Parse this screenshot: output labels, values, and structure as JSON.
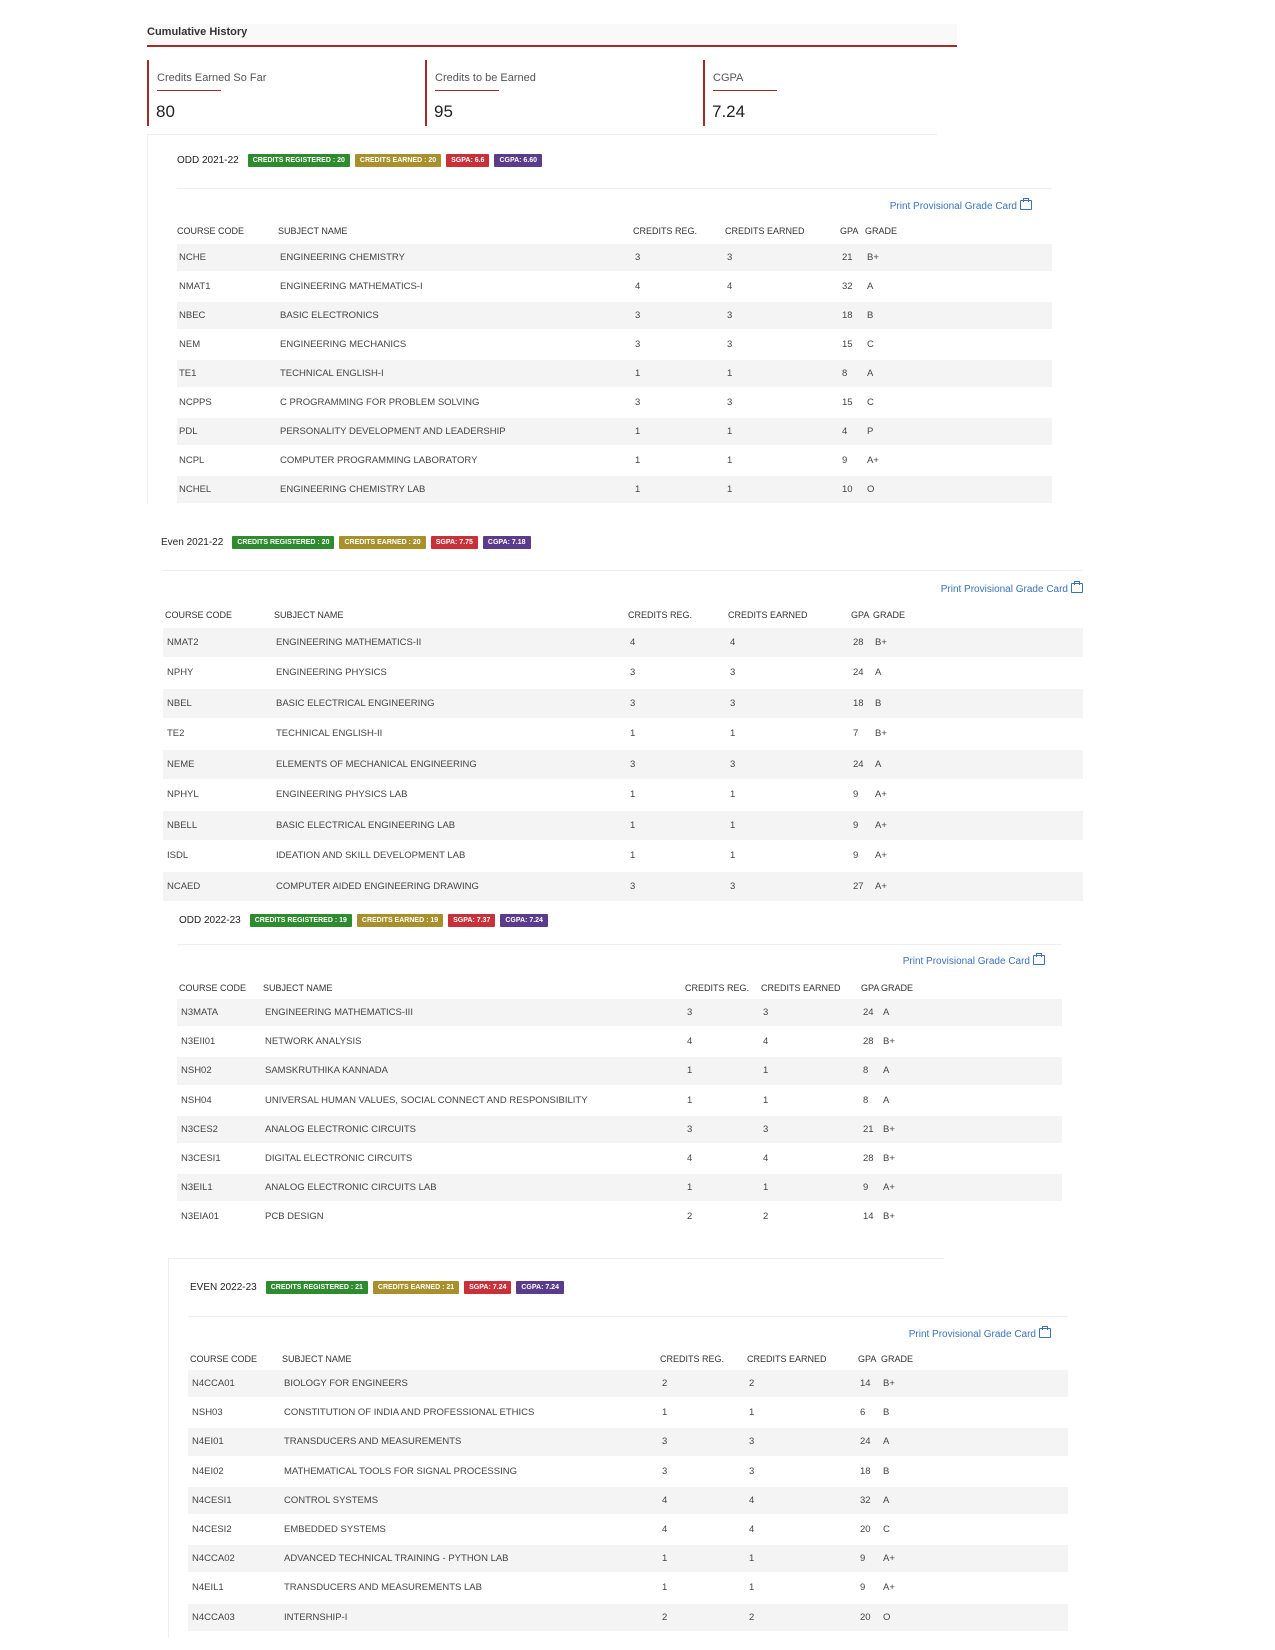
{
  "header": {
    "title": "Cumulative History"
  },
  "stats": [
    {
      "label": "Credits Earned So Far",
      "value": "80"
    },
    {
      "label": "Credits to be Earned",
      "value": "95"
    },
    {
      "label": "CGPA",
      "value": "7.24"
    }
  ],
  "print_label": "Print Provisional Grade Card",
  "columns": {
    "code": "COURSE CODE",
    "name": "SUBJECT NAME",
    "reg": "CREDITS REG.",
    "earned": "CREDITS EARNED",
    "gpa": "GPA",
    "grade": "GRADE"
  },
  "semesters": [
    {
      "name": "ODD 2021-22",
      "badges": {
        "registered": "CREDITS REGISTERED : 20",
        "earned": "CREDITS EARNED : 20",
        "sgpa": "SGPA: 6.6",
        "cgpa": "CGPA: 6.60"
      },
      "rows": [
        [
          "NCHE",
          "ENGINEERING CHEMISTRY",
          "3",
          "3",
          "21",
          "B+"
        ],
        [
          "NMAT1",
          "ENGINEERING MATHEMATICS-I",
          "4",
          "4",
          "32",
          "A"
        ],
        [
          "NBEC",
          "BASIC ELECTRONICS",
          "3",
          "3",
          "18",
          "B"
        ],
        [
          "NEM",
          "ENGINEERING MECHANICS",
          "3",
          "3",
          "15",
          "C"
        ],
        [
          "TE1",
          "TECHNICAL ENGLISH-I",
          "1",
          "1",
          "8",
          "A"
        ],
        [
          "NCPPS",
          "C PROGRAMMING FOR PROBLEM SOLVING",
          "3",
          "3",
          "15",
          "C"
        ],
        [
          "PDL",
          "PERSONALITY DEVELOPMENT AND LEADERSHIP",
          "1",
          "1",
          "4",
          "P"
        ],
        [
          "NCPL",
          "COMPUTER PROGRAMMING LABORATORY",
          "1",
          "1",
          "9",
          "A+"
        ],
        [
          "NCHEL",
          "ENGINEERING CHEMISTRY LAB",
          "1",
          "1",
          "10",
          "O"
        ]
      ]
    },
    {
      "name": "Even 2021-22",
      "badges": {
        "registered": "CREDITS REGISTERED : 20",
        "earned": "CREDITS EARNED : 20",
        "sgpa": "SGPA: 7.75",
        "cgpa": "CGPA: 7.18"
      },
      "rows": [
        [
          "NMAT2",
          "ENGINEERING MATHEMATICS-II",
          "4",
          "4",
          "28",
          "B+"
        ],
        [
          "NPHY",
          "ENGINEERING PHYSICS",
          "3",
          "3",
          "24",
          "A"
        ],
        [
          "NBEL",
          "BASIC ELECTRICAL ENGINEERING",
          "3",
          "3",
          "18",
          "B"
        ],
        [
          "TE2",
          "TECHNICAL ENGLISH-II",
          "1",
          "1",
          "7",
          "B+"
        ],
        [
          "NEME",
          "ELEMENTS OF MECHANICAL ENGINEERING",
          "3",
          "3",
          "24",
          "A"
        ],
        [
          "NPHYL",
          "ENGINEERING PHYSICS LAB",
          "1",
          "1",
          "9",
          "A+"
        ],
        [
          "NBELL",
          "BASIC ELECTRICAL ENGINEERING LAB",
          "1",
          "1",
          "9",
          "A+"
        ],
        [
          "ISDL",
          "IDEATION AND SKILL DEVELOPMENT LAB",
          "1",
          "1",
          "9",
          "A+"
        ],
        [
          "NCAED",
          "COMPUTER AIDED ENGINEERING DRAWING",
          "3",
          "3",
          "27",
          "A+"
        ]
      ]
    },
    {
      "name": "ODD 2022-23",
      "badges": {
        "registered": "CREDITS REGISTERED : 19",
        "earned": "CREDITS EARNED : 19",
        "sgpa": "SGPA: 7.37",
        "cgpa": "CGPA: 7.24"
      },
      "rows": [
        [
          "N3MATA",
          "ENGINEERING MATHEMATICS-III",
          "3",
          "3",
          "24",
          "A"
        ],
        [
          "N3EII01",
          "NETWORK ANALYSIS",
          "4",
          "4",
          "28",
          "B+"
        ],
        [
          "NSH02",
          "SAMSKRUTHIKA KANNADA",
          "1",
          "1",
          "8",
          "A"
        ],
        [
          "NSH04",
          "UNIVERSAL HUMAN VALUES, SOCIAL CONNECT AND RESPONSIBILITY",
          "1",
          "1",
          "8",
          "A"
        ],
        [
          "N3CES2",
          "ANALOG ELECTRONIC CIRCUITS",
          "3",
          "3",
          "21",
          "B+"
        ],
        [
          "N3CESI1",
          "DIGITAL ELECTRONIC CIRCUITS",
          "4",
          "4",
          "28",
          "B+"
        ],
        [
          "N3EIL1",
          "ANALOG ELECTRONIC CIRCUITS LAB",
          "1",
          "1",
          "9",
          "A+"
        ],
        [
          "N3EIA01",
          "PCB DESIGN",
          "2",
          "2",
          "14",
          "B+"
        ]
      ]
    },
    {
      "name": "EVEN 2022-23",
      "badges": {
        "registered": "CREDITS REGISTERED : 21",
        "earned": "CREDITS EARNED : 21",
        "sgpa": "SGPA: 7.24",
        "cgpa": "CGPA: 7.24"
      },
      "rows": [
        [
          "N4CCA01",
          "BIOLOGY FOR ENGINEERS",
          "2",
          "2",
          "14",
          "B+"
        ],
        [
          "NSH03",
          "CONSTITUTION OF INDIA AND PROFESSIONAL ETHICS",
          "1",
          "1",
          "6",
          "B"
        ],
        [
          "N4EI01",
          "TRANSDUCERS AND MEASUREMENTS",
          "3",
          "3",
          "24",
          "A"
        ],
        [
          "N4EI02",
          "MATHEMATICAL TOOLS FOR SIGNAL PROCESSING",
          "3",
          "3",
          "18",
          "B"
        ],
        [
          "N4CESI1",
          "CONTROL SYSTEMS",
          "4",
          "4",
          "32",
          "A"
        ],
        [
          "N4CESI2",
          "EMBEDDED SYSTEMS",
          "4",
          "4",
          "20",
          "C"
        ],
        [
          "N4CCA02",
          "ADVANCED TECHNICAL TRAINING - PYTHON LAB",
          "1",
          "1",
          "9",
          "A+"
        ],
        [
          "N4EIL1",
          "TRANSDUCERS AND MEASUREMENTS LAB",
          "1",
          "1",
          "9",
          "A+"
        ],
        [
          "N4CCA03",
          "INTERNSHIP-I",
          "2",
          "2",
          "20",
          "O"
        ]
      ]
    }
  ],
  "colors": {
    "accent": "#a52a2a",
    "link": "#3a72b8",
    "registered": "#2e8b2e",
    "earned": "#a8912d",
    "sgpa": "#c8313a",
    "cgpa": "#5b3b8b"
  }
}
